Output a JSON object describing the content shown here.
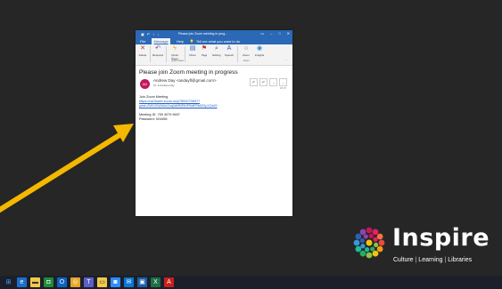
{
  "window": {
    "title": "Please join Zoom meeting in prog...",
    "menu": [
      "File",
      "Message",
      "Help"
    ],
    "tell_me": "Tell me what you want to do",
    "ribbon": {
      "buttons": [
        {
          "label": "Delete",
          "icon": "delete-icon"
        },
        {
          "label": "Respond",
          "icon": "reply-icon"
        },
        {
          "label": "Quick Steps",
          "icon": "lightning-icon"
        },
        {
          "label": "Move",
          "icon": "move-icon"
        },
        {
          "label": "Tags",
          "icon": "flag-icon"
        },
        {
          "label": "Editing",
          "icon": "search-icon"
        },
        {
          "label": "Speech",
          "icon": "speech-icon"
        },
        {
          "label": "Zoom",
          "icon": "zoom-icon"
        },
        {
          "label": "Insights",
          "icon": "insights-icon"
        }
      ],
      "group_labels": {
        "quick_steps": "Quick Steps",
        "zoom": "Zoom"
      }
    },
    "subject": "Please join Zoom meeting in progress",
    "sender": {
      "initials": "AD",
      "from": "Andrew Day <andayfl@gmail.com>",
      "to": "To: ● Andrew Day",
      "date": "15:07"
    },
    "message": {
      "line1": "Join Zoom Meeting",
      "link1": "https://us04web.zoom.us/j/7594079697?",
      "link2": "pwd=ZWVVN2h0cGxqWkR0RHFBdFRMZGpYZz09",
      "meeting_id": "Meeting ID: 759 4079 9697",
      "password": "Password: 924458"
    }
  },
  "logo": {
    "word": "Inspire",
    "tagline_parts": [
      "Culture",
      "Learning",
      "Libraries"
    ]
  },
  "annotation": {
    "color": "#f5b800"
  },
  "taskbar": {
    "icons": [
      "windows-start-icon",
      "edge-icon",
      "file-explorer-icon",
      "store-icon",
      "outlook-icon",
      "chrome-icon",
      "teams-icon",
      "folder-icon",
      "zoom-app-icon",
      "mail-icon",
      "photos-icon",
      "excel-icon",
      "acrobat-icon"
    ]
  }
}
